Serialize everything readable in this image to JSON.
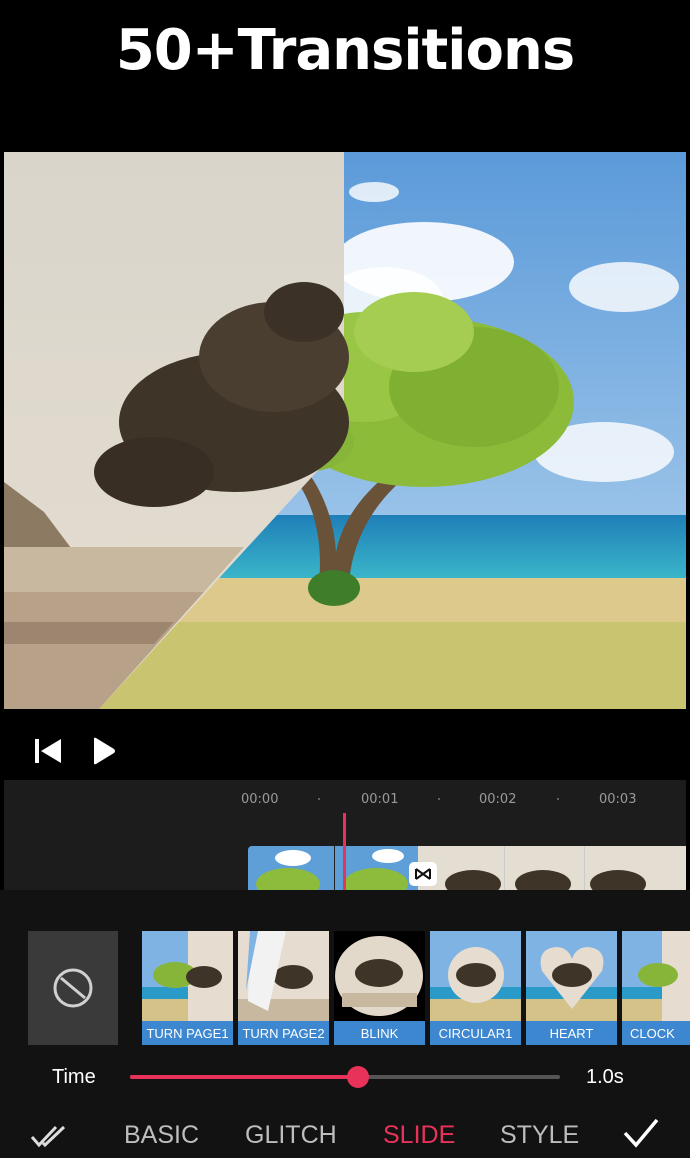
{
  "headline": "50+Transitions",
  "player": {
    "rewind_icon": "skip-to-start-icon",
    "play_icon": "play-icon"
  },
  "timeline": {
    "ruler": [
      "00:00",
      "00:01",
      "00:02",
      "00:03"
    ],
    "transition_marker_icon": "bowtie-transition-icon"
  },
  "transitions": [
    {
      "label": "TURN PAGE1"
    },
    {
      "label": "TURN PAGE2"
    },
    {
      "label": "BLINK"
    },
    {
      "label": "CIRCULAR1"
    },
    {
      "label": "HEART"
    },
    {
      "label": "CLOCK"
    }
  ],
  "time": {
    "label": "Time",
    "value": "1.0s",
    "slider_fraction": 0.53
  },
  "tabs": {
    "apply_all_icon": "double-check-icon",
    "items": [
      "BASIC",
      "GLITCH",
      "SLIDE",
      "STYLE"
    ],
    "active": "SLIDE",
    "confirm_icon": "check-icon"
  },
  "colors": {
    "accent": "#e8325a",
    "caption": "#3d87d0"
  }
}
